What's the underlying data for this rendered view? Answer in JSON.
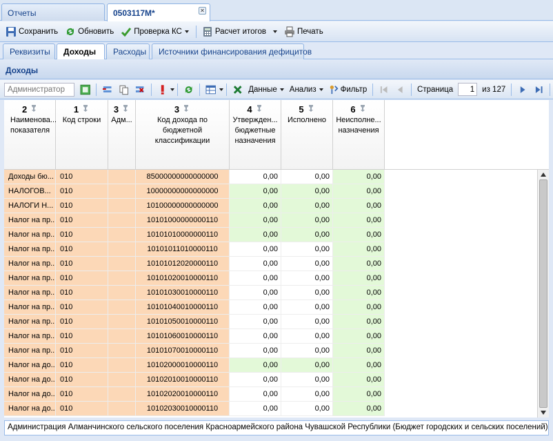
{
  "top_tabs": [
    {
      "label": "Отчеты"
    },
    {
      "label": "0503117M*"
    }
  ],
  "toolbar": {
    "save": "Сохранить",
    "refresh": "Обновить",
    "check": "Проверка КС",
    "calc": "Расчет итогов",
    "print": "Печать"
  },
  "sub_tabs": [
    {
      "label": "Реквизиты"
    },
    {
      "label": "Доходы"
    },
    {
      "label": "Расходы"
    },
    {
      "label": "Источники финансирования дефицитов"
    }
  ],
  "panel_title": "Доходы",
  "grid_toolbar": {
    "filter_placeholder": "Администратор",
    "data_label": "Данные",
    "analysis_label": "Анализ",
    "filter_label": "Фильтр",
    "page_label": "Страница",
    "page_value": "1",
    "page_total": "из 127"
  },
  "columns": [
    {
      "num": "2",
      "title": "Наименова... показателя"
    },
    {
      "num": "1",
      "title": "Код строки"
    },
    {
      "num": "3",
      "title": "Адм..."
    },
    {
      "num": "3",
      "title": "Код дохода по бюджетной классификации"
    },
    {
      "num": "4",
      "title": "Утвержден... бюджетные назначения"
    },
    {
      "num": "5",
      "title": "Исполнено"
    },
    {
      "num": "6",
      "title": "Неисполне... назначения"
    }
  ],
  "rows": [
    {
      "name": "Доходы бю...",
      "code": "010",
      "adm": "",
      "kbk": "85000000000000000",
      "approved": "0,00",
      "done": "0,00",
      "undone": "0,00",
      "ag": false,
      "dg": false
    },
    {
      "name": "НАЛОГОВ...",
      "code": "010",
      "adm": "",
      "kbk": "10000000000000000",
      "approved": "0,00",
      "done": "0,00",
      "undone": "0,00",
      "ag": true,
      "dg": true
    },
    {
      "name": "НАЛОГИ Н...",
      "code": "010",
      "adm": "",
      "kbk": "10100000000000000",
      "approved": "0,00",
      "done": "0,00",
      "undone": "0,00",
      "ag": true,
      "dg": true
    },
    {
      "name": "Налог на пр...",
      "code": "010",
      "adm": "",
      "kbk": "10101000000000110",
      "approved": "0,00",
      "done": "0,00",
      "undone": "0,00",
      "ag": true,
      "dg": true
    },
    {
      "name": "Налог на пр...",
      "code": "010",
      "adm": "",
      "kbk": "10101010000000110",
      "approved": "0,00",
      "done": "0,00",
      "undone": "0,00",
      "ag": true,
      "dg": true
    },
    {
      "name": "Налог на пр...",
      "code": "010",
      "adm": "",
      "kbk": "10101011010000110",
      "approved": "0,00",
      "done": "0,00",
      "undone": "0,00",
      "ag": false,
      "dg": false
    },
    {
      "name": "Налог на пр...",
      "code": "010",
      "adm": "",
      "kbk": "10101012020000110",
      "approved": "0,00",
      "done": "0,00",
      "undone": "0,00",
      "ag": false,
      "dg": false
    },
    {
      "name": "Налог на пр...",
      "code": "010",
      "adm": "",
      "kbk": "10101020010000110",
      "approved": "0,00",
      "done": "0,00",
      "undone": "0,00",
      "ag": false,
      "dg": false
    },
    {
      "name": "Налог на пр...",
      "code": "010",
      "adm": "",
      "kbk": "10101030010000110",
      "approved": "0,00",
      "done": "0,00",
      "undone": "0,00",
      "ag": false,
      "dg": false
    },
    {
      "name": "Налог на пр...",
      "code": "010",
      "adm": "",
      "kbk": "10101040010000110",
      "approved": "0,00",
      "done": "0,00",
      "undone": "0,00",
      "ag": false,
      "dg": false
    },
    {
      "name": "Налог на пр...",
      "code": "010",
      "adm": "",
      "kbk": "10101050010000110",
      "approved": "0,00",
      "done": "0,00",
      "undone": "0,00",
      "ag": false,
      "dg": false
    },
    {
      "name": "Налог на пр...",
      "code": "010",
      "adm": "",
      "kbk": "10101060010000110",
      "approved": "0,00",
      "done": "0,00",
      "undone": "0,00",
      "ag": false,
      "dg": false
    },
    {
      "name": "Налог на пр...",
      "code": "010",
      "adm": "",
      "kbk": "10101070010000110",
      "approved": "0,00",
      "done": "0,00",
      "undone": "0,00",
      "ag": false,
      "dg": false
    },
    {
      "name": "Налог на до...",
      "code": "010",
      "adm": "",
      "kbk": "10102000010000110",
      "approved": "0,00",
      "done": "0,00",
      "undone": "0,00",
      "ag": true,
      "dg": true
    },
    {
      "name": "Налог на до...",
      "code": "010",
      "adm": "",
      "kbk": "10102010010000110",
      "approved": "0,00",
      "done": "0,00",
      "undone": "0,00",
      "ag": false,
      "dg": false
    },
    {
      "name": "Налог на до...",
      "code": "010",
      "adm": "",
      "kbk": "10102020010000110",
      "approved": "0,00",
      "done": "0,00",
      "undone": "0,00",
      "ag": false,
      "dg": false
    },
    {
      "name": "Налог на до...",
      "code": "010",
      "adm": "",
      "kbk": "10102030010000110",
      "approved": "0,00",
      "done": "0,00",
      "undone": "0,00",
      "ag": false,
      "dg": false
    }
  ],
  "status": "Администрация Алманчинского сельского поселения Красноармейского района Чувашской Республики (Бюджет городских и сельских поселений)",
  "colors": {
    "peach": "#fcd8b7",
    "green": "#e3f9d8",
    "accent": "#15428b"
  }
}
